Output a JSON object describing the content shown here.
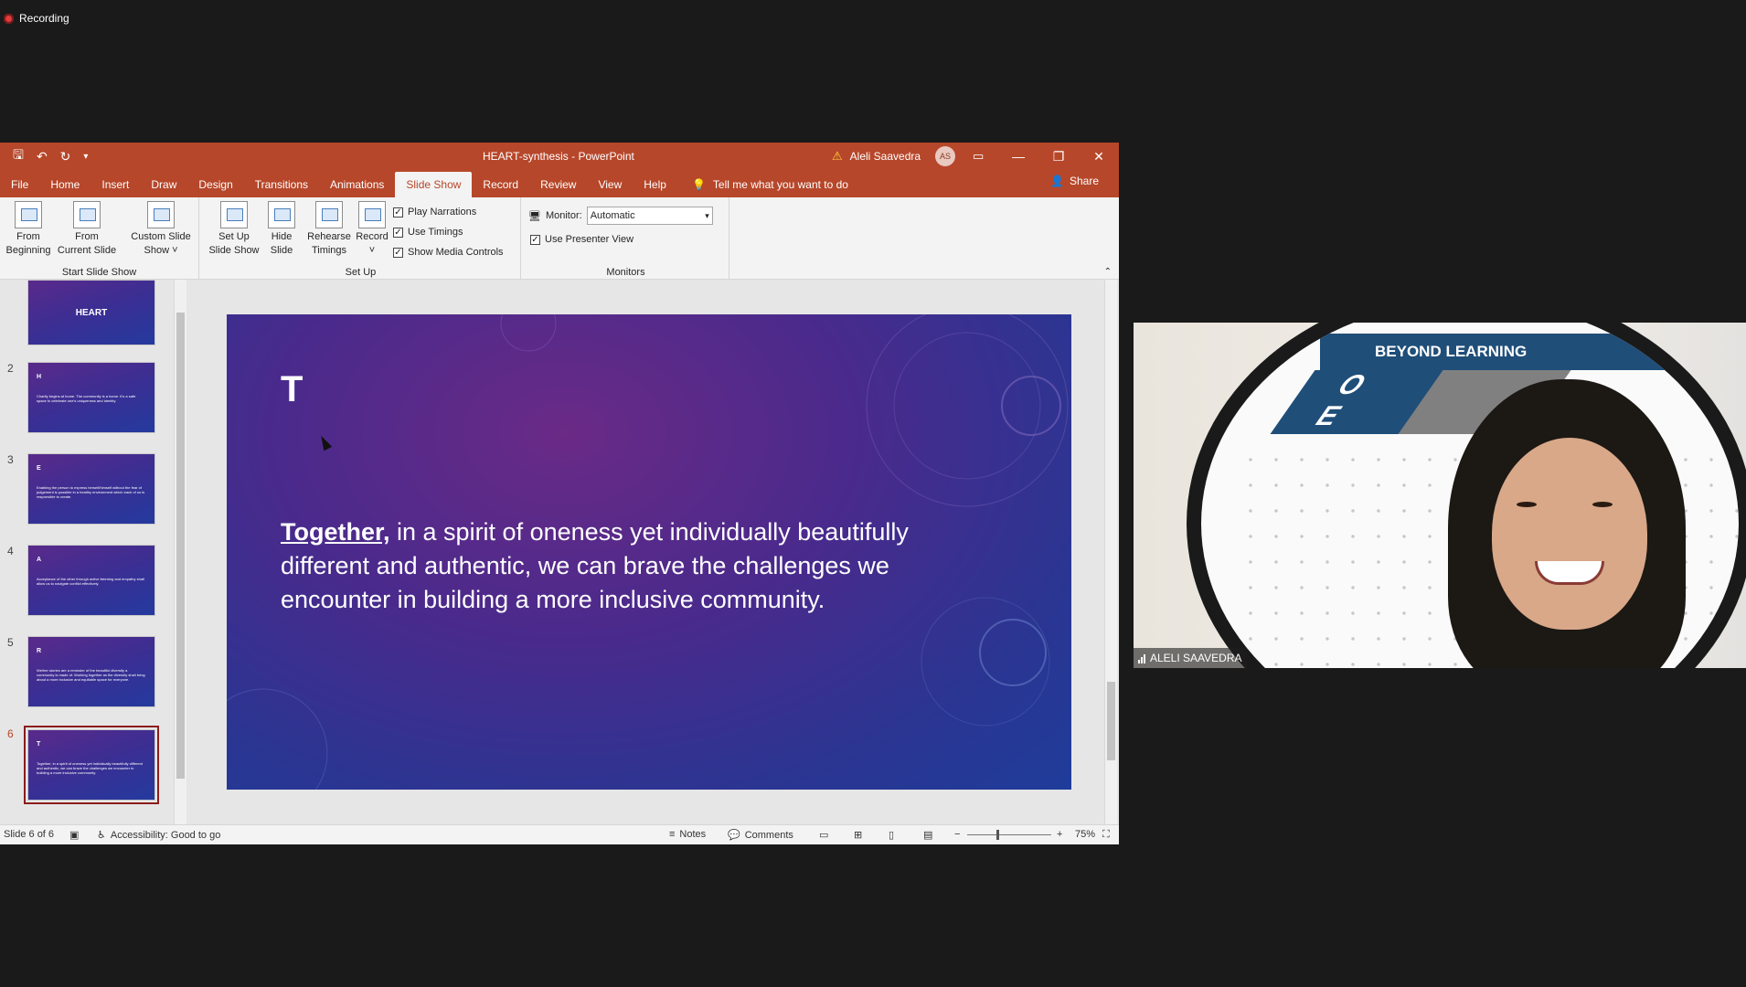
{
  "recording": {
    "label": "Recording"
  },
  "window": {
    "doc_title": "HEART-synthesis  -  PowerPoint",
    "user_name": "Aleli Saavedra",
    "user_initials": "AS"
  },
  "tabs": [
    "File",
    "Home",
    "Insert",
    "Draw",
    "Design",
    "Transitions",
    "Animations",
    "Slide Show",
    "Record",
    "Review",
    "View",
    "Help"
  ],
  "active_tab": "Slide Show",
  "tellme": "Tell me what you want to do",
  "share": "Share",
  "ribbon": {
    "start_group": "Start Slide Show",
    "setup_group": "Set Up",
    "monitors_group": "Monitors",
    "from_beginning": [
      "From",
      "Beginning"
    ],
    "from_current": [
      "From",
      "Current Slide"
    ],
    "custom_show": [
      "Custom Slide",
      "Show ˅"
    ],
    "setup_show": [
      "Set Up",
      "Slide Show"
    ],
    "hide_slide": [
      "Hide",
      "Slide"
    ],
    "rehearse": [
      "Rehearse",
      "Timings"
    ],
    "record": [
      "Record",
      "˅"
    ],
    "play_narrations": "Play Narrations",
    "use_timings": "Use Timings",
    "show_media": "Show Media Controls",
    "monitor_label": "Monitor:",
    "monitor_value": "Automatic",
    "presenter_view": "Use Presenter View"
  },
  "thumbnails": [
    {
      "num": "",
      "title": "",
      "center": "HEART",
      "body": ""
    },
    {
      "num": "2",
      "title": "H",
      "center": "",
      "body": "Charity begins at home. The community is a home. It's a safe space to celebrate one's uniqueness and identity."
    },
    {
      "num": "3",
      "title": "E",
      "center": "",
      "body": "Enabling the person to express herself/himself without the fear of judgement is possible in a healthy environment which each of us is responsible to create."
    },
    {
      "num": "4",
      "title": "A",
      "center": "",
      "body": "Acceptance of the other through active listening and empathy shall allow us to navigate conflict effectively."
    },
    {
      "num": "5",
      "title": "R",
      "center": "",
      "body": "We/her stories are a reminder of the beautiful diversity a community is made of. Working together as the diversity shall bring about a more inclusive and equitable space for everyone."
    },
    {
      "num": "6",
      "title": "T",
      "center": "",
      "body": "Together, in a spirit of oneness yet individually beautifully different and authentic, we can brave the challenges we encounter in building a more inclusive community."
    }
  ],
  "slide": {
    "title": "T",
    "highlight": "Together,",
    "body": " in a spirit of oneness yet individually beautifully different and authentic, we can brave the challenges we encounter in building a more inclusive community."
  },
  "status": {
    "slide_count": "Slide 6 of 6",
    "accessibility": "Accessibility: Good to go",
    "notes": "Notes",
    "comments": "Comments",
    "zoom": "75%"
  },
  "video": {
    "participant": "ALELI SAAVEDRA",
    "banner": "BEYOND LEARNING",
    "banner_letters": "O\nE"
  },
  "colors": {
    "accent": "#b7472a",
    "active_thumb": "#8c1c1c"
  }
}
